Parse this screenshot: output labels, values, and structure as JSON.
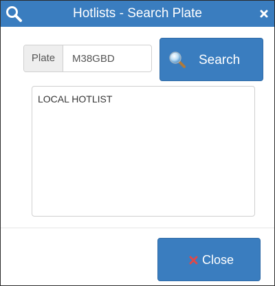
{
  "dialog": {
    "title": "Hotlists - Search Plate",
    "title_icon": "search-icon",
    "close_icon": "close-icon"
  },
  "search_form": {
    "plate_label": "Plate",
    "plate_value": "M38GBD",
    "plate_placeholder": "",
    "search_button_label": "Search",
    "search_button_icon": "magnifier-icon"
  },
  "results": {
    "text": "LOCAL HOTLIST"
  },
  "footer": {
    "close_button_label": "Close",
    "close_button_icon": "close-x-icon"
  },
  "colors": {
    "accent": "#3a7dbf",
    "close_x": "#e04848"
  }
}
